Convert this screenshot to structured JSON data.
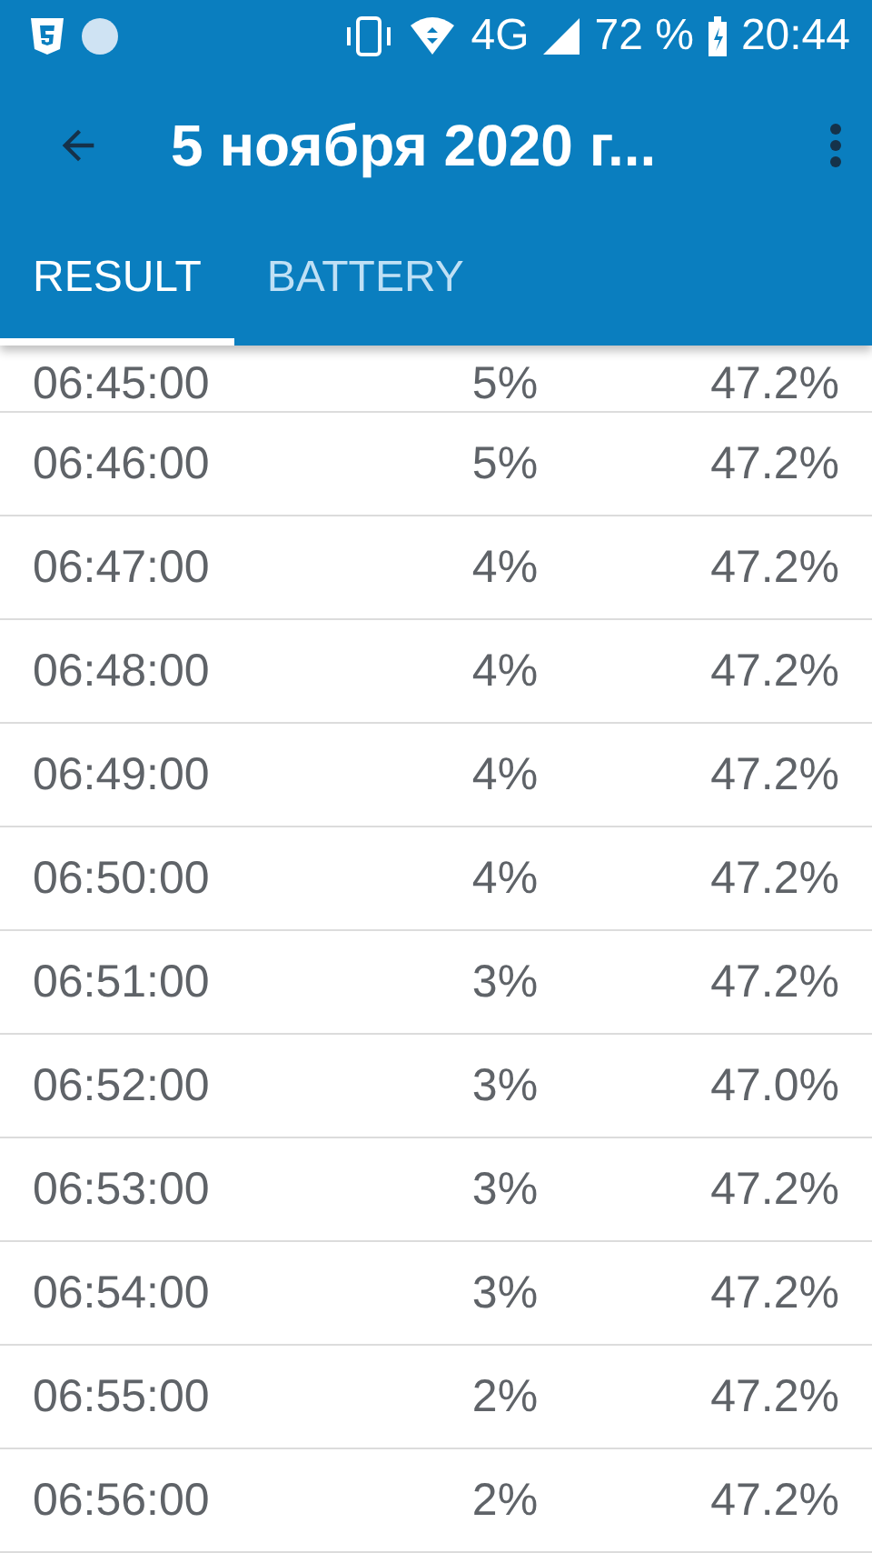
{
  "status_bar": {
    "signal_label": "4G",
    "battery_percent": "72 %",
    "time": "20:44"
  },
  "toolbar": {
    "title": "5 ноября 2020 г..."
  },
  "tabs": [
    {
      "label": "RESULT",
      "selected": true
    },
    {
      "label": "BATTERY",
      "selected": false
    }
  ],
  "rows": [
    {
      "time": "06:45:00",
      "column_2": "5%",
      "column_3": "47.2%"
    },
    {
      "time": "06:46:00",
      "column_2": "5%",
      "column_3": "47.2%"
    },
    {
      "time": "06:47:00",
      "column_2": "4%",
      "column_3": "47.2%"
    },
    {
      "time": "06:48:00",
      "column_2": "4%",
      "column_3": "47.2%"
    },
    {
      "time": "06:49:00",
      "column_2": "4%",
      "column_3": "47.2%"
    },
    {
      "time": "06:50:00",
      "column_2": "4%",
      "column_3": "47.2%"
    },
    {
      "time": "06:51:00",
      "column_2": "3%",
      "column_3": "47.2%"
    },
    {
      "time": "06:52:00",
      "column_2": "3%",
      "column_3": "47.0%"
    },
    {
      "time": "06:53:00",
      "column_2": "3%",
      "column_3": "47.2%"
    },
    {
      "time": "06:54:00",
      "column_2": "3%",
      "column_3": "47.2%"
    },
    {
      "time": "06:55:00",
      "column_2": "2%",
      "column_3": "47.2%"
    },
    {
      "time": "06:56:00",
      "column_2": "2%",
      "column_3": "47.2%"
    }
  ]
}
